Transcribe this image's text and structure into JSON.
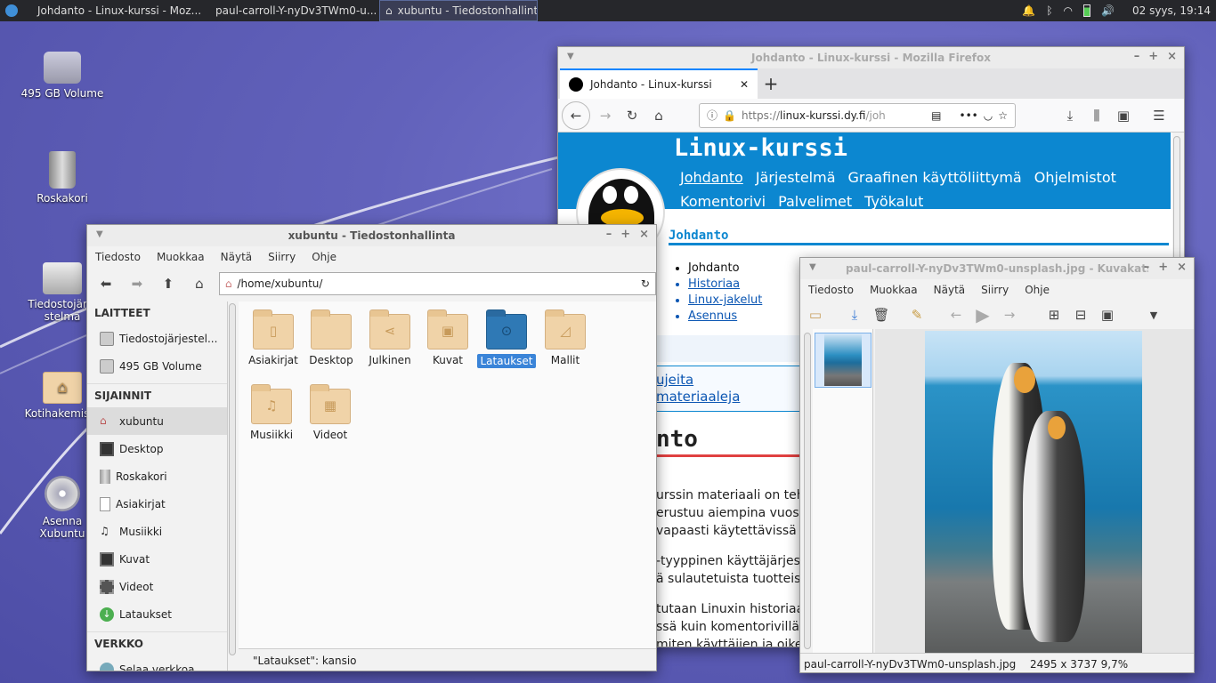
{
  "panel": {
    "tasks": [
      {
        "label": "Johdanto - Linux-kurssi - Moz..."
      },
      {
        "label": "paul-carroll-Y-nyDv3TWm0-u..."
      },
      {
        "label": "xubuntu - Tiedostonhallinta"
      }
    ],
    "clock": "02 syys, 19:14"
  },
  "desktop": {
    "icons": [
      {
        "label": "495 GB Volume"
      },
      {
        "label": "Roskakori"
      },
      {
        "label": "Tiedostojärjestelmä"
      },
      {
        "label": "Kotihakemisto"
      },
      {
        "label": "Asenna Xubuntu 18.04"
      }
    ]
  },
  "firefox": {
    "title": "Johdanto - Linux-kurssi - Mozilla Firefox",
    "tab": "Johdanto - Linux-kurssi",
    "url_prefix": "https://",
    "url_host": "linux-kurssi.dy.fi",
    "url_rest": "/joh",
    "site_title": "Linux-kurssi",
    "nav": [
      "Johdanto",
      "Järjestelmä",
      "Graafinen käyttöliittymä",
      "Ohjelmistot",
      "Komentorivi",
      "Palvelimet",
      "Työkalut"
    ],
    "section": "Johdanto",
    "toc": [
      "Johdanto",
      "Historiaa",
      "Linux-jakelut",
      "Asennus"
    ],
    "box_lines": [
      "ujeita",
      "materiaaleja"
    ],
    "heading": "nto",
    "para1": [
      "urssin materiaali on teh",
      "erustuu aiempina vuosi",
      "vapaasti käytettävissä ("
    ],
    "para2": [
      "-tyyppinen käyttäjärjest",
      "ä sulautetuista tuotteist"
    ],
    "para3": [
      "tutaan Linuxin historiaa",
      "ssä kuin komentorivillä",
      "miten käyttäjien ja oike"
    ]
  },
  "thunar": {
    "title": "xubuntu - Tiedostonhallinta",
    "menu": [
      "Tiedosto",
      "Muokkaa",
      "Näytä",
      "Siirry",
      "Ohje"
    ],
    "path": "/home/xubuntu/",
    "side": {
      "h1": "LAITTEET",
      "devices": [
        "Tiedostojärjestel...",
        "495 GB Volume"
      ],
      "h2": "SIJAINNIT",
      "places": [
        "xubuntu",
        "Desktop",
        "Roskakori",
        "Asiakirjat",
        "Musiikki",
        "Kuvat",
        "Videot",
        "Lataukset"
      ],
      "h3": "VERKKO",
      "network": [
        "Selaa verkkoa"
      ]
    },
    "folders": [
      {
        "label": "Asiakirjat"
      },
      {
        "label": "Desktop"
      },
      {
        "label": "Julkinen"
      },
      {
        "label": "Kuvat"
      },
      {
        "label": "Lataukset"
      },
      {
        "label": "Mallit"
      },
      {
        "label": "Musiikki"
      },
      {
        "label": "Videot"
      }
    ],
    "status": "\"Lataukset\": kansio"
  },
  "viewer": {
    "title": "paul-carroll-Y-nyDv3TWm0-unsplash.jpg - Kuvakatselin",
    "menu": [
      "Tiedosto",
      "Muokkaa",
      "Näytä",
      "Siirry",
      "Ohje"
    ],
    "status_file": "paul-carroll-Y-nyDv3TWm0-unsplash.jpg",
    "status_info": "2495 x 3737  9,7%"
  }
}
